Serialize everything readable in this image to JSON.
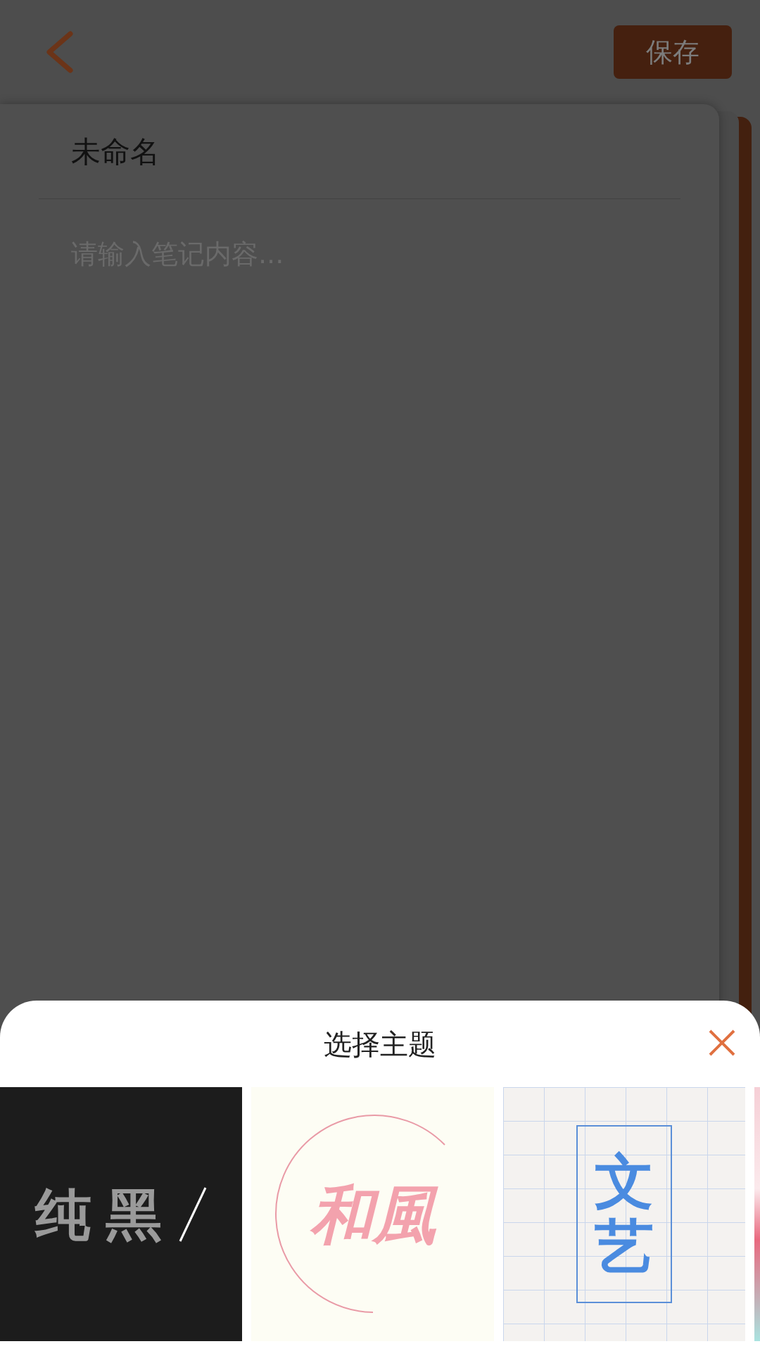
{
  "header": {
    "save_button": "保存"
  },
  "note": {
    "title": "未命名",
    "content_placeholder": "请输入笔记内容..."
  },
  "theme_sheet": {
    "title": "选择主题",
    "themes": [
      {
        "kind": "black",
        "name": "纯黑"
      },
      {
        "kind": "wafu",
        "name": "和風"
      },
      {
        "kind": "grid",
        "name": "文艺"
      },
      {
        "kind": "pastel"
      }
    ]
  }
}
